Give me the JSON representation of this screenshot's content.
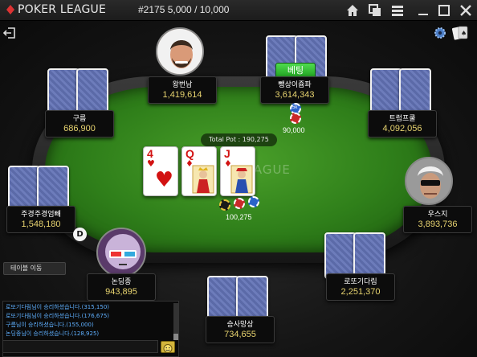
{
  "titlebar": {
    "app_title": "POKER LEAGUE",
    "table_info": "#2175 5,000 / 10,000"
  },
  "table": {
    "felt_logo": "LEAGUE",
    "total_pot": "Total Pot : 190,275",
    "pot_chips_amount": "100,275",
    "board_cards": [
      {
        "rank": "4",
        "suit": "♥"
      },
      {
        "rank": "Q",
        "suit": "♦"
      },
      {
        "rank": "J",
        "suit": "♦"
      }
    ],
    "dealer_button": "D",
    "table_move_button": "테이블 이동"
  },
  "players": [
    {
      "id": "top-center",
      "name": "왕번남",
      "stack": "1,419,614"
    },
    {
      "id": "top-right",
      "name": "뺑상이쥼파",
      "stack": "3,614,343",
      "action": "베팅",
      "bet": "90,000",
      "bet_chip": "5k"
    },
    {
      "id": "upper-left",
      "name": "구름",
      "stack": "686,900"
    },
    {
      "id": "upper-right",
      "name": "트럼프쿨",
      "stack": "4,092,056"
    },
    {
      "id": "mid-left",
      "name": "주경주경엄빼",
      "stack": "1,548,180"
    },
    {
      "id": "mid-right",
      "name": "우스지",
      "stack": "3,893,736"
    },
    {
      "id": "lower-left",
      "name": "논딩종",
      "stack": "943,895"
    },
    {
      "id": "lower-right",
      "name": "로또기다림",
      "stack": "2,251,370"
    },
    {
      "id": "bottom-center",
      "name": "승사망상",
      "stack": "734,655"
    }
  ],
  "chat": {
    "lines": [
      "로또기다림님이 승리하셨습니다.(315,150)",
      "로또기다림님이 승리하셨습니다.(176,675)",
      "구름님이 승리하셨습니다.(155,000)",
      "논딩종님이 승리하셨습니다.(128,925)"
    ],
    "input_placeholder": ""
  },
  "colors": {
    "felt": "#2f7f1a",
    "stack_text": "#e8d470",
    "bet_badge": "#2fbf2f",
    "chat_text": "#5fb0ff"
  }
}
